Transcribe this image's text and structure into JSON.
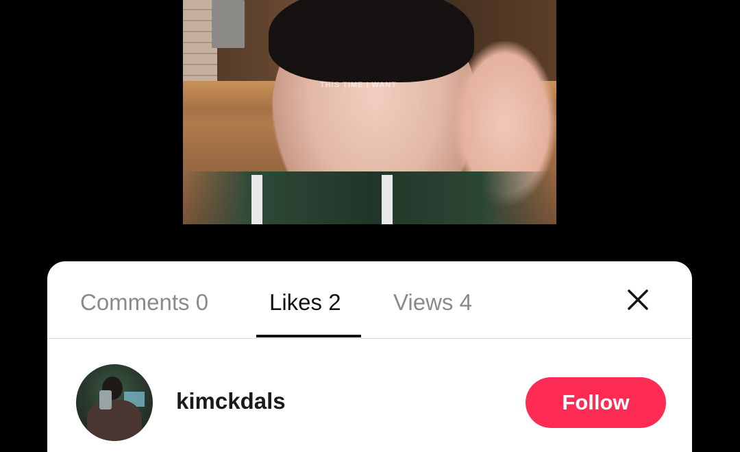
{
  "video": {
    "caption_overlay": "THIS TIME I WANT"
  },
  "sheet": {
    "tabs": [
      {
        "label": "Comments 0",
        "active": false
      },
      {
        "label": "Likes 2",
        "active": true
      },
      {
        "label": "Views 4",
        "active": false
      }
    ],
    "close_icon": "close-icon"
  },
  "likes": [
    {
      "username": "kimckdals",
      "follow_label": "Follow",
      "avatar_icon": "avatar"
    }
  ],
  "colors": {
    "follow_button": "#fe2c55",
    "active_tab": "#111111",
    "inactive_tab": "#8a8a8a",
    "background": "#000000"
  }
}
